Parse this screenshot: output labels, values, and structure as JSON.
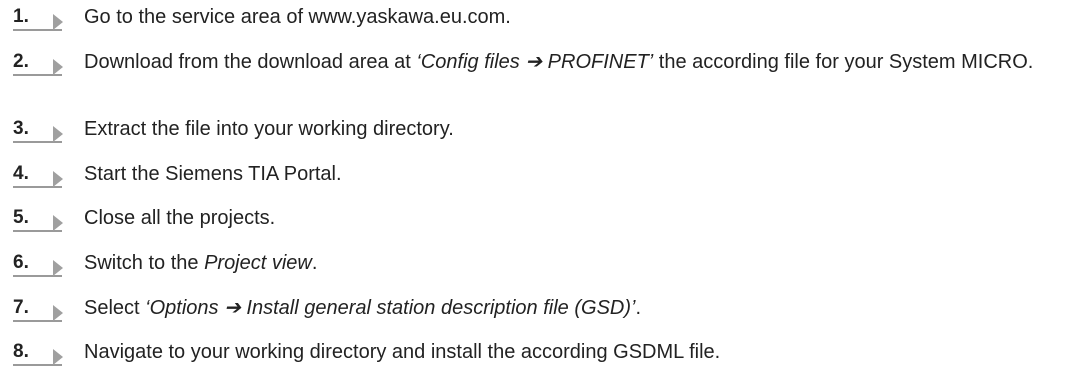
{
  "steps": [
    {
      "number": "1.",
      "parts": [
        {
          "text": "Go to the service area of www.yaskawa.eu.com.",
          "italic": false
        }
      ]
    },
    {
      "number": "2.",
      "parts": [
        {
          "text": "Download from the download area at ",
          "italic": false
        },
        {
          "text": "‘Config files ➔ PROFINET’",
          "italic": true
        },
        {
          "text": " the according file for your System MICRO.",
          "italic": false
        }
      ]
    },
    {
      "number": "3.",
      "parts": [
        {
          "text": "Extract the file into your working directory.",
          "italic": false
        }
      ]
    },
    {
      "number": "4.",
      "parts": [
        {
          "text": "Start the Siemens TIA Portal.",
          "italic": false
        }
      ]
    },
    {
      "number": "5.",
      "parts": [
        {
          "text": "Close all the projects.",
          "italic": false
        }
      ]
    },
    {
      "number": "6.",
      "parts": [
        {
          "text": "Switch to the ",
          "italic": false
        },
        {
          "text": "Project view",
          "italic": true
        },
        {
          "text": ".",
          "italic": false
        }
      ]
    },
    {
      "number": "7.",
      "parts": [
        {
          "text": "Select ",
          "italic": false
        },
        {
          "text": "‘Options ➔ Install general station description file (GSD)’",
          "italic": true
        },
        {
          "text": ".",
          "italic": false
        }
      ]
    },
    {
      "number": "8.",
      "parts": [
        {
          "text": "Navigate to your working directory and install the according GSDML file.",
          "italic": false
        }
      ]
    }
  ]
}
